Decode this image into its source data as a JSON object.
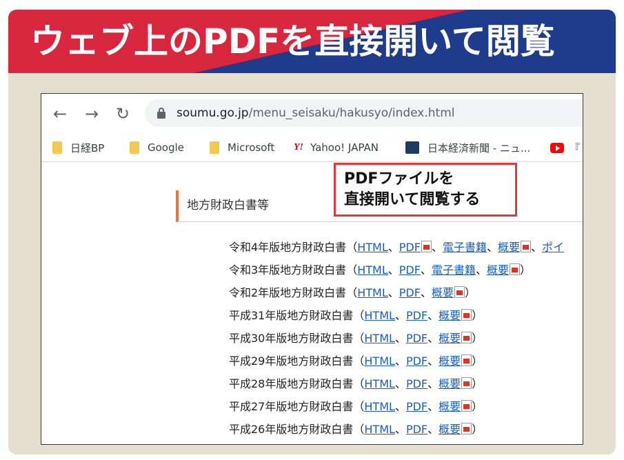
{
  "banner": {
    "title": "ウェブ上のPDFを直接開いて閲覧"
  },
  "browser": {
    "nav": {
      "back_icon": "arrow-left-icon",
      "forward_icon": "arrow-right-icon",
      "reload_icon": "reload-icon"
    },
    "url": {
      "host": "soumu.go.jp",
      "path": "/menu_seisaku/hakusyo/index.html"
    },
    "bookmarks": [
      "日経BP",
      "Google",
      "Microsoft",
      "Yahoo! JAPAN",
      "日本経済新聞 - ニュ...",
      "『"
    ]
  },
  "callout": {
    "line1": "PDFファイルを",
    "line2": "直接開いて閲覧する"
  },
  "page": {
    "heading": "地方財政白書等",
    "reports": [
      {
        "title": "令和4年版地方財政白書",
        "links": [
          "HTML",
          "PDF",
          "電子書籍",
          "概要",
          "ポイ"
        ],
        "pdf_after": [
          1,
          3
        ]
      },
      {
        "title": "令和3年版地方財政白書",
        "links": [
          "HTML",
          "PDF",
          "電子書籍",
          "概要"
        ],
        "pdf_after": [
          3
        ]
      },
      {
        "title": "令和2年版地方財政白書",
        "links": [
          "HTML",
          "PDF",
          "概要"
        ],
        "pdf_after": [
          2
        ]
      },
      {
        "title": "平成31年版地方財政白書",
        "links": [
          "HTML",
          "PDF",
          "概要"
        ],
        "pdf_after": [
          2
        ]
      },
      {
        "title": "平成30年版地方財政白書",
        "links": [
          "HTML",
          "PDF",
          "概要"
        ],
        "pdf_after": [
          2
        ]
      },
      {
        "title": "平成29年版地方財政白書",
        "links": [
          "HTML",
          "PDF",
          "概要"
        ],
        "pdf_after": [
          2
        ]
      },
      {
        "title": "平成28年版地方財政白書",
        "links": [
          "HTML",
          "PDF",
          "概要"
        ],
        "pdf_after": [
          2
        ]
      },
      {
        "title": "平成27年版地方財政白書",
        "links": [
          "HTML",
          "PDF",
          "概要"
        ],
        "pdf_after": [
          2
        ]
      },
      {
        "title": "平成26年版地方財政白書",
        "links": [
          "HTML",
          "PDF",
          "概要"
        ],
        "pdf_after": [
          2
        ]
      }
    ]
  }
}
